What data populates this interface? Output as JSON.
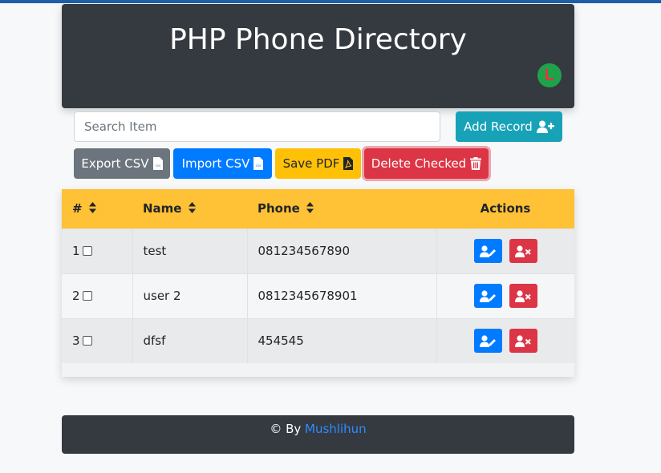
{
  "header": {
    "title": "PHP Phone Directory",
    "logo_letter": "L"
  },
  "search": {
    "placeholder": "Search Item",
    "value": ""
  },
  "toolbar": {
    "add_label": "Add Record",
    "export_label": "Export CSV",
    "import_label": "Import CSV",
    "pdf_label": "Save PDF",
    "delete_label": "Delete Checked"
  },
  "table": {
    "columns": {
      "num": "#",
      "name": "Name",
      "phone": "Phone",
      "actions": "Actions"
    },
    "rows": [
      {
        "num": "1",
        "name": "test",
        "phone": "081234567890"
      },
      {
        "num": "2",
        "name": "user 2",
        "phone": "0812345678901"
      },
      {
        "num": "3",
        "name": "dfsf",
        "phone": "454545"
      }
    ]
  },
  "footer": {
    "prefix": "© By ",
    "author": "Mushlihun"
  },
  "colors": {
    "header_bg": "#343a40",
    "table_head_bg": "#ffc135",
    "primary": "#007bff",
    "danger": "#dc3545",
    "info": "#17a2b8",
    "secondary": "#6c757d",
    "warning": "#ffc107"
  },
  "icons": {
    "add": "user-plus-icon",
    "export": "csv-file-icon",
    "import": "csv-file-icon",
    "pdf": "pdf-file-icon",
    "delete": "trash-icon",
    "sort": "sort-icon",
    "edit": "user-edit-icon",
    "remove": "user-remove-icon"
  }
}
